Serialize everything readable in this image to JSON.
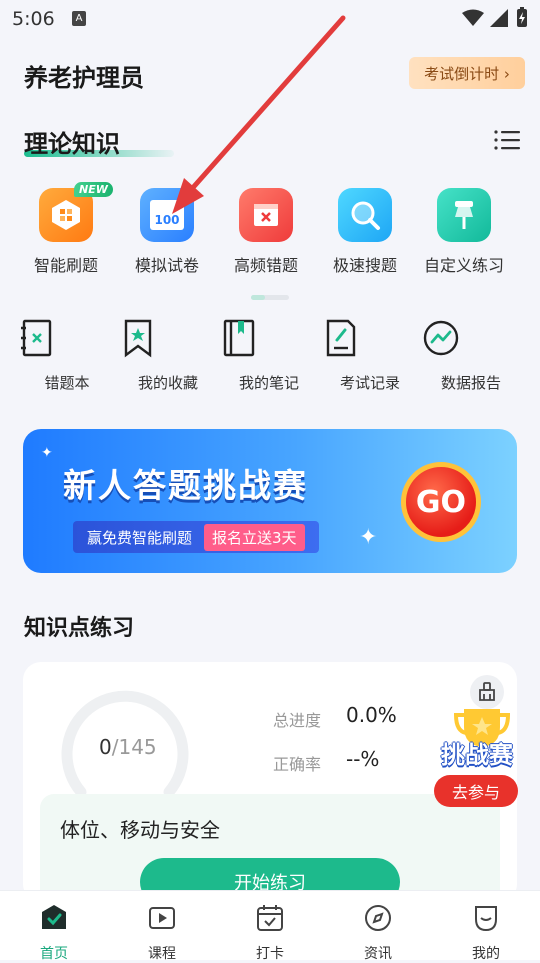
{
  "status": {
    "time": "5:06",
    "indicator": "A"
  },
  "header": {
    "title": "养老护理员",
    "countdown_label": "考试倒计时 ›"
  },
  "theory": {
    "title": "理论知识",
    "main_items": [
      {
        "label": "智能刷题",
        "badge": "NEW",
        "icon": "smart-practice-icon"
      },
      {
        "label": "模拟试卷",
        "icon": "mock-exam-icon",
        "icon_text": "100"
      },
      {
        "label": "高频错题",
        "icon": "frequent-mistakes-icon"
      },
      {
        "label": "极速搜题",
        "icon": "search-question-icon"
      },
      {
        "label": "自定义练习",
        "icon": "custom-practice-icon"
      }
    ],
    "sub_items": [
      {
        "label": "错题本",
        "icon": "mistake-book-icon"
      },
      {
        "label": "我的收藏",
        "icon": "favorites-icon"
      },
      {
        "label": "我的笔记",
        "icon": "notes-icon"
      },
      {
        "label": "考试记录",
        "icon": "exam-record-icon"
      },
      {
        "label": "数据报告",
        "icon": "data-report-icon"
      }
    ]
  },
  "banner": {
    "title": "新人答题挑战赛",
    "subtitle_left": "赢免费智能刷题",
    "subtitle_right": "报名立送3天",
    "go_label": "GO"
  },
  "knowledge": {
    "title": "知识点练习",
    "progress_done": "0",
    "progress_total": "/145",
    "progress_fraction": 0,
    "total_progress_label": "总进度",
    "total_progress_value": "0.0%",
    "accuracy_label": "正确率",
    "accuracy_value": "--%",
    "topic": "体位、移动与安全",
    "start_label": "开始练习"
  },
  "challenge": {
    "title": "挑战赛",
    "join_label": "去参与"
  },
  "tabs": [
    {
      "label": "首页",
      "icon": "home-icon",
      "active": true
    },
    {
      "label": "课程",
      "icon": "course-play-icon",
      "active": false
    },
    {
      "label": "打卡",
      "icon": "checkin-calendar-icon",
      "active": false
    },
    {
      "label": "资讯",
      "icon": "compass-icon",
      "active": false
    },
    {
      "label": "我的",
      "icon": "profile-icon",
      "active": false
    }
  ],
  "colors": {
    "accent": "#1dba8c",
    "banner_blue": "#1f7bff",
    "go_red": "#e61d18",
    "countdown_bg": "#ffd9b0"
  }
}
